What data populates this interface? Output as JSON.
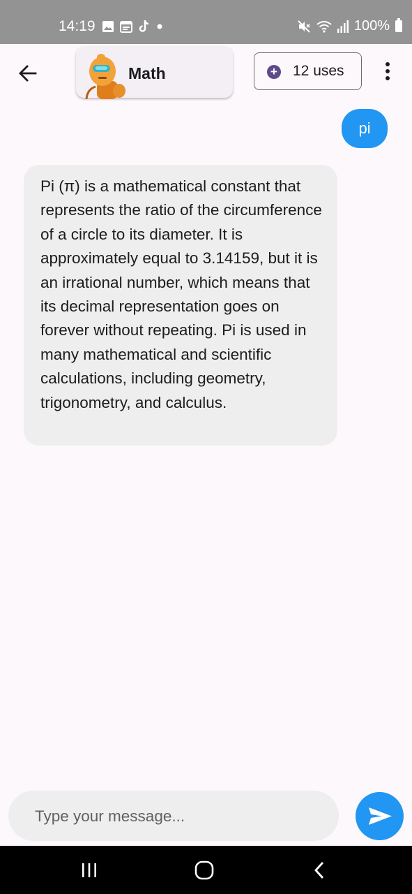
{
  "status_bar": {
    "time": "14:19",
    "battery": "100%",
    "icons_left": [
      "image-icon",
      "calendar-icon",
      "tiktok-icon",
      "dot-icon"
    ],
    "icons_right": [
      "mute-icon",
      "wifi-icon",
      "signal-icon",
      "battery-icon"
    ]
  },
  "header": {
    "bot_name": "Math",
    "uses_label": "12 uses"
  },
  "messages": {
    "user": "pi",
    "bot": "Pi (π) is a mathematical constant that represents the ratio of the circumference of a circle to its diameter. It is approximately equal to 3.14159, but it is an irrational number, which means that its decimal representation goes on forever without repeating. Pi is used in many mathematical and scientific calculations, including geometry, trigonometry, and calculus."
  },
  "composer": {
    "placeholder": "Type your message..."
  },
  "colors": {
    "accent": "#2196f3",
    "bubble_bot": "#eeeeee",
    "status_bar": "#939393",
    "uses_icon": "#5f4a8b"
  }
}
